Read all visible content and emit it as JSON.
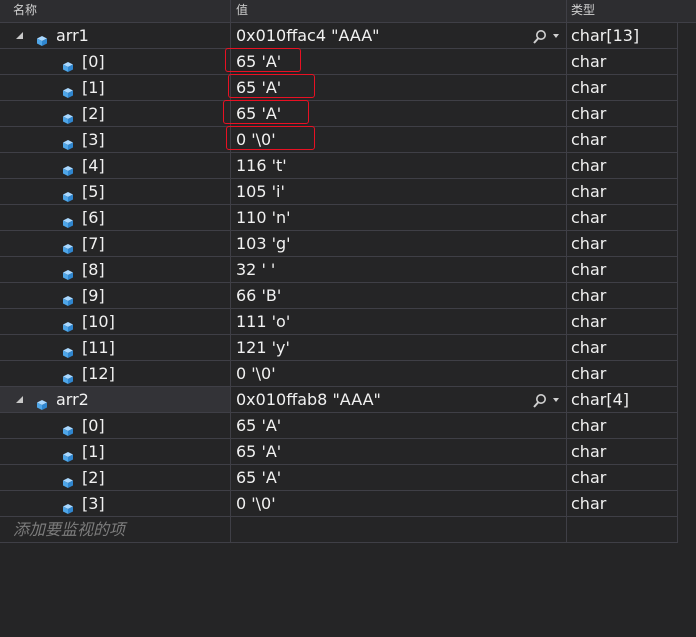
{
  "columns": {
    "name": "名称",
    "value": "值",
    "type": "类型"
  },
  "rows": [
    {
      "name": "arr1",
      "value": "0x010ffac4 \"AAA\"",
      "type": "char[13]",
      "level": 0,
      "expandable": true,
      "has_magnifier": true,
      "highlighted": false
    },
    {
      "name": "[0]",
      "value": "65 'A'",
      "type": "char",
      "level": 1,
      "highlighted": true
    },
    {
      "name": "[1]",
      "value": "65 'A'",
      "type": "char",
      "level": 1,
      "highlighted": true
    },
    {
      "name": "[2]",
      "value": "65 'A'",
      "type": "char",
      "level": 1,
      "highlighted": true
    },
    {
      "name": "[3]",
      "value": "0 '\\0'",
      "type": "char",
      "level": 1,
      "highlighted": true
    },
    {
      "name": "[4]",
      "value": "116 't'",
      "type": "char",
      "level": 1
    },
    {
      "name": "[5]",
      "value": "105 'i'",
      "type": "char",
      "level": 1
    },
    {
      "name": "[6]",
      "value": "110 'n'",
      "type": "char",
      "level": 1
    },
    {
      "name": "[7]",
      "value": "103 'g'",
      "type": "char",
      "level": 1
    },
    {
      "name": "[8]",
      "value": "32 ' '",
      "type": "char",
      "level": 1
    },
    {
      "name": "[9]",
      "value": "66 'B'",
      "type": "char",
      "level": 1
    },
    {
      "name": "[10]",
      "value": "111 'o'",
      "type": "char",
      "level": 1
    },
    {
      "name": "[11]",
      "value": "121 'y'",
      "type": "char",
      "level": 1
    },
    {
      "name": "[12]",
      "value": "0 '\\0'",
      "type": "char",
      "level": 1
    },
    {
      "name": "arr2",
      "value": "0x010ffab8 \"AAA\"",
      "type": "char[4]",
      "level": 0,
      "expandable": true,
      "has_magnifier": true,
      "selected": true
    },
    {
      "name": "[0]",
      "value": "65 'A'",
      "type": "char",
      "level": 1
    },
    {
      "name": "[1]",
      "value": "65 'A'",
      "type": "char",
      "level": 1
    },
    {
      "name": "[2]",
      "value": "65 'A'",
      "type": "char",
      "level": 1
    },
    {
      "name": "[3]",
      "value": "0 '\\0'",
      "type": "char",
      "level": 1
    }
  ],
  "add_watch_placeholder": "添加要监视的项",
  "colors": {
    "background": "#252526",
    "grid": "#3f3f46",
    "highlight_box": "#e81123",
    "cube_icon": "#75beff",
    "text": "#f1f1f1"
  },
  "icons": {
    "expander": "expanded-triangle-icon",
    "variable": "variable-cube-icon",
    "magnifier": "magnifier-icon"
  }
}
